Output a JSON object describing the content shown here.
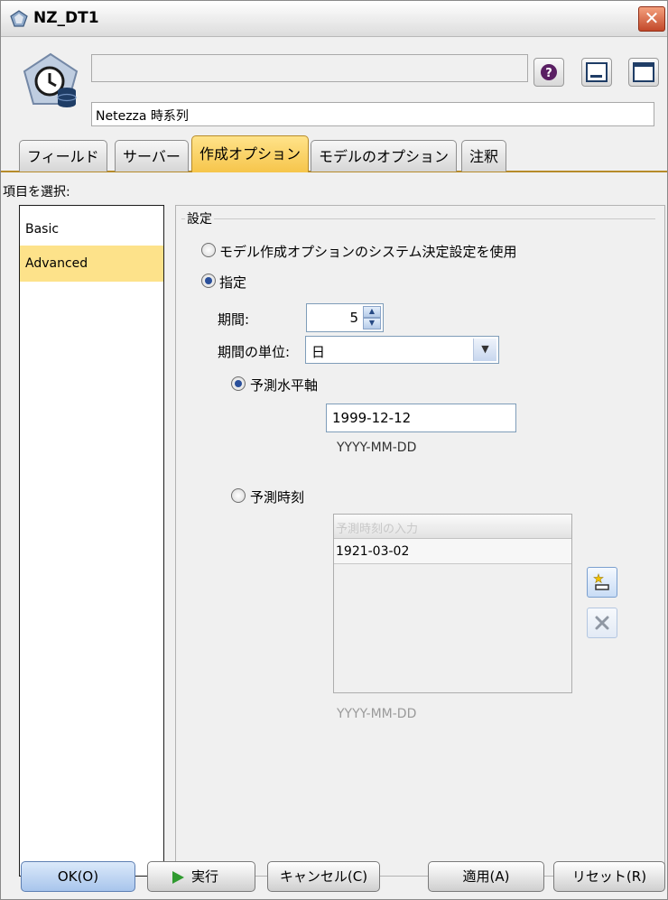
{
  "window": {
    "title": "NZ_DT1",
    "close_glyph": "✕"
  },
  "header": {
    "node_name": "",
    "subtitle": "Netezza 時系列"
  },
  "tabs": [
    {
      "label": "フィールド"
    },
    {
      "label": "サーバー"
    },
    {
      "label": "作成オプション"
    },
    {
      "label": "モデルのオプション"
    },
    {
      "label": "注釈"
    }
  ],
  "sidebar": {
    "heading": "項目を選択:",
    "items": [
      {
        "label": "Basic"
      },
      {
        "label": "Advanced"
      }
    ],
    "selected": "Advanced"
  },
  "settings": {
    "group_label": "設定",
    "radio_system": "モデル作成オプションのシステム決定設定を使用",
    "radio_specify": "指定",
    "period_label": "期間:",
    "period_value": "5",
    "unit_label": "期間の単位:",
    "unit_value": "日",
    "forecast_horizon_label": "予測水平軸",
    "forecast_horizon_value": "1999-12-12",
    "date_format": "YYYY-MM-DD",
    "forecast_times_label": "予測時刻",
    "times_header": "予測時刻の入力",
    "times": [
      "1921-03-02"
    ],
    "date_format_dim": "YYYY-MM-DD"
  },
  "footer": {
    "ok": "OK(O)",
    "run": "実行",
    "cancel": "キャンセル(C)",
    "apply": "適用(A)",
    "reset": "リセット(R)"
  },
  "colors": {
    "active_tab": "#f6c54b",
    "selected_item": "#fde28a",
    "accent_blue": "#2a4f9a"
  }
}
